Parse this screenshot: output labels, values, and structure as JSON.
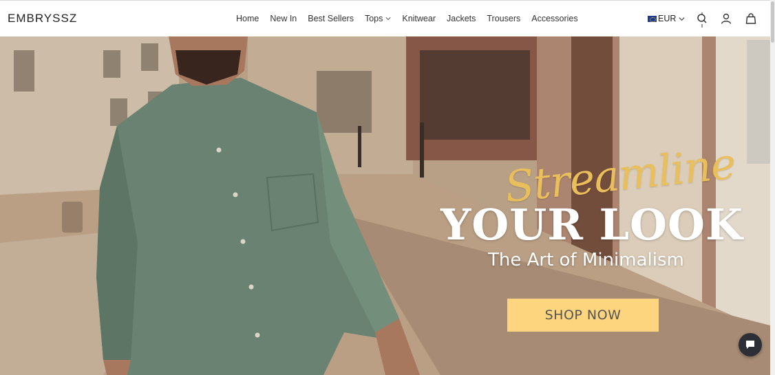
{
  "brand": {
    "logo_text": "EMBRYSSZ"
  },
  "nav": {
    "items": [
      {
        "label": "Home"
      },
      {
        "label": "New In"
      },
      {
        "label": "Best Sellers"
      },
      {
        "label": "Tops",
        "has_dropdown": true
      },
      {
        "label": "Knitwear"
      },
      {
        "label": "Jackets"
      },
      {
        "label": "Trousers"
      },
      {
        "label": "Accessories"
      }
    ]
  },
  "header_actions": {
    "currency": "EUR",
    "icons": [
      "search-icon",
      "account-icon",
      "cart-bag-icon"
    ]
  },
  "hero": {
    "script_text": "Streamline",
    "headline": "YOUR LOOK",
    "subheadline": "The Art of Minimalism",
    "cta_label": "SHOP NOW"
  },
  "colors": {
    "accent_gold": "#e9bf5c",
    "cta_background": "#fdd57e",
    "chat_bubble": "#2d2f36"
  }
}
